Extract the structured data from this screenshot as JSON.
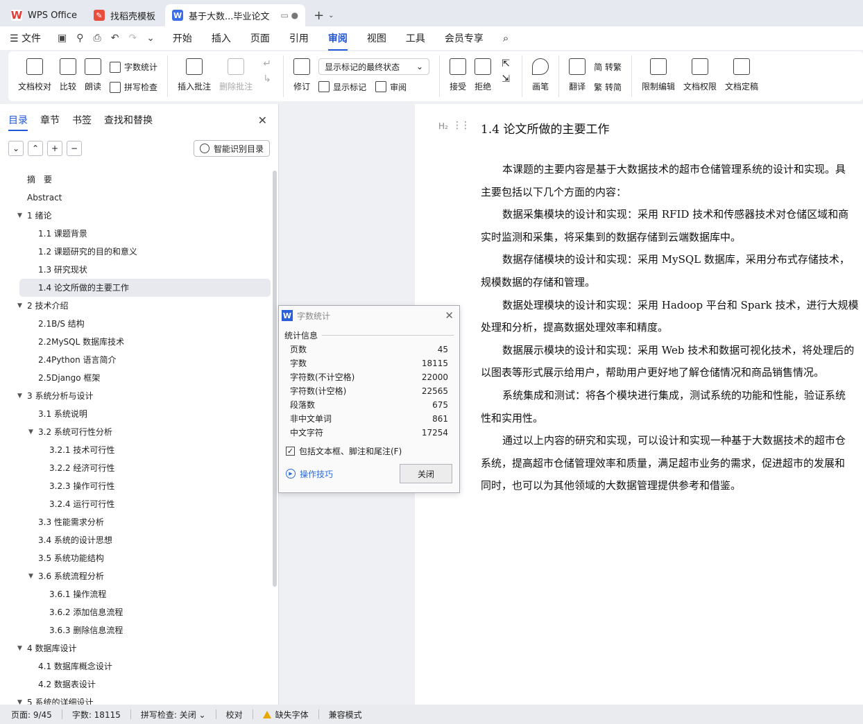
{
  "tabs": [
    {
      "label": "WPS Office",
      "icon": "wps-logo-icon"
    },
    {
      "label": "找稻壳模板",
      "icon": "docer-icon"
    },
    {
      "label": "基于大数...毕业论文",
      "icon": "writer-doc-icon"
    }
  ],
  "menu": {
    "file": "文件",
    "items": [
      "开始",
      "插入",
      "页面",
      "引用",
      "审阅",
      "视图",
      "工具",
      "会员专享"
    ],
    "active": "审阅"
  },
  "ribbon": {
    "doc_proofread": "文档校对",
    "compare": "比较",
    "read_aloud": "朗读",
    "word_count": "字数统计",
    "spell_check": "拼写检查",
    "insert_comment": "插入批注",
    "delete_comment": "删除批注",
    "track_changes": "修订",
    "display_dropdown": "显示标记的最终状态",
    "show_markup": "显示标记",
    "review": "审阅",
    "accept": "接受",
    "reject": "拒绝",
    "pen": "画笔",
    "translate": "翻译",
    "to_traditional": "简 转繁",
    "to_simplified": "繁 转简",
    "restrict_edit": "限制编辑",
    "doc_permission": "文档权限",
    "finalize": "文档定稿"
  },
  "nav": {
    "tabs": [
      "目录",
      "章节",
      "书签",
      "查找和替换"
    ],
    "active_tab": "目录",
    "smart_toc": "智能识别目录",
    "toc": [
      {
        "label": "摘　要",
        "level": 0,
        "arrow": ""
      },
      {
        "label": "Abstract",
        "level": 0,
        "arrow": ""
      },
      {
        "label": "1  绪论",
        "level": 0,
        "arrow": "down"
      },
      {
        "label": "1.1 课题背景",
        "level": 1,
        "arrow": ""
      },
      {
        "label": "1.2 课题研究的目的和意义",
        "level": 1,
        "arrow": ""
      },
      {
        "label": "1.3  研究现状",
        "level": 1,
        "arrow": ""
      },
      {
        "label": "1.4 论文所做的主要工作",
        "level": 1,
        "arrow": "",
        "selected": true
      },
      {
        "label": "2  技术介绍",
        "level": 0,
        "arrow": "down"
      },
      {
        "label": "2.1B/S 结构",
        "level": 1,
        "arrow": ""
      },
      {
        "label": "2.2MySQL 数据库技术",
        "level": 1,
        "arrow": ""
      },
      {
        "label": "2.4Python 语言简介",
        "level": 1,
        "arrow": ""
      },
      {
        "label": "2.5Django 框架",
        "level": 1,
        "arrow": ""
      },
      {
        "label": "3  系统分析与设计",
        "level": 0,
        "arrow": "down"
      },
      {
        "label": "3.1 系统说明",
        "level": 1,
        "arrow": ""
      },
      {
        "label": "3.2 系统可行性分析",
        "level": 1,
        "arrow": "down"
      },
      {
        "label": "3.2.1  技术可行性",
        "level": 2,
        "arrow": ""
      },
      {
        "label": "3.2.2  经济可行性",
        "level": 2,
        "arrow": ""
      },
      {
        "label": "3.2.3 操作可行性",
        "level": 2,
        "arrow": ""
      },
      {
        "label": "3.2.4 运行可行性",
        "level": 2,
        "arrow": ""
      },
      {
        "label": "3.3  性能需求分析",
        "level": 1,
        "arrow": ""
      },
      {
        "label": "3.4 系统的设计思想",
        "level": 1,
        "arrow": ""
      },
      {
        "label": "3.5 系统功能结构",
        "level": 1,
        "arrow": ""
      },
      {
        "label": "3.6 系统流程分析",
        "level": 1,
        "arrow": "down"
      },
      {
        "label": "3.6.1 操作流程",
        "level": 2,
        "arrow": ""
      },
      {
        "label": "3.6.2 添加信息流程",
        "level": 2,
        "arrow": ""
      },
      {
        "label": "3.6.3 删除信息流程",
        "level": 2,
        "arrow": ""
      },
      {
        "label": "4  数据库设计",
        "level": 0,
        "arrow": "down"
      },
      {
        "label": "4.1 数据库概念设计",
        "level": 1,
        "arrow": ""
      },
      {
        "label": "4.2 数据表设计",
        "level": 1,
        "arrow": ""
      },
      {
        "label": "5  系统的详细设计",
        "level": 0,
        "arrow": "down"
      }
    ]
  },
  "document": {
    "heading_marker": "H₂",
    "heading": "1.4 论文所做的主要工作",
    "lines": [
      {
        "text": "本课题的主要内容是基于大数据技术的超市仓储管理系统的设计和实现。具",
        "indent": true
      },
      {
        "text": "主要包括以下几个方面的内容：",
        "indent": false
      },
      {
        "text": "数据采集模块的设计和实现：采用 RFID 技术和传感器技术对仓储区域和商",
        "indent": true
      },
      {
        "text": "实时监测和采集，将采集到的数据存储到云端数据库中。",
        "indent": false
      },
      {
        "text": "数据存储模块的设计和实现：采用 MySQL 数据库，采用分布式存储技术，",
        "indent": true
      },
      {
        "text": "规模数据的存储和管理。",
        "indent": false
      },
      {
        "text": "数据处理模块的设计和实现：采用 Hadoop 平台和 Spark 技术，进行大规模",
        "indent": true
      },
      {
        "text": "处理和分析，提高数据处理效率和精度。",
        "indent": false
      },
      {
        "text": "数据展示模块的设计和实现：采用 Web 技术和数据可视化技术，将处理后的",
        "indent": true
      },
      {
        "text": "以图表等形式展示给用户，帮助用户更好地了解仓储情况和商品销售情况。",
        "indent": false
      },
      {
        "text": "系统集成和测试：将各个模块进行集成，测试系统的功能和性能，验证系统",
        "indent": true
      },
      {
        "text": "性和实用性。",
        "indent": false
      },
      {
        "text": "通过以上内容的研究和实现，可以设计和实现一种基于大数据技术的超市仓",
        "indent": true
      },
      {
        "text": "系统，提高超市仓储管理效率和质量，满足超市业务的需求，促进超市的发展和",
        "indent": false
      },
      {
        "text": "同时，也可以为其他领域的大数据管理提供参考和借鉴。",
        "indent": false
      }
    ]
  },
  "dialog": {
    "title": "字数统计",
    "section": "统计信息",
    "stats": [
      {
        "label": "页数",
        "value": "45"
      },
      {
        "label": "字数",
        "value": "18115"
      },
      {
        "label": "字符数(不计空格)",
        "value": "22000"
      },
      {
        "label": "字符数(计空格)",
        "value": "22565"
      },
      {
        "label": "段落数",
        "value": "675"
      },
      {
        "label": "非中文单词",
        "value": "861"
      },
      {
        "label": "中文字符",
        "value": "17254"
      }
    ],
    "checkbox_label": "包括文本框、脚注和尾注(F)",
    "checkbox_checked": true,
    "tips": "操作技巧",
    "close": "关闭"
  },
  "status": {
    "page": "页面: 9/45",
    "words": "字数: 18115",
    "spell": "拼写检查: 关闭",
    "proof": "校对",
    "missing_font": "缺失字体",
    "compat": "兼容模式"
  },
  "colors": {
    "accent": "#2256d6",
    "brand_red": "#e53935"
  }
}
